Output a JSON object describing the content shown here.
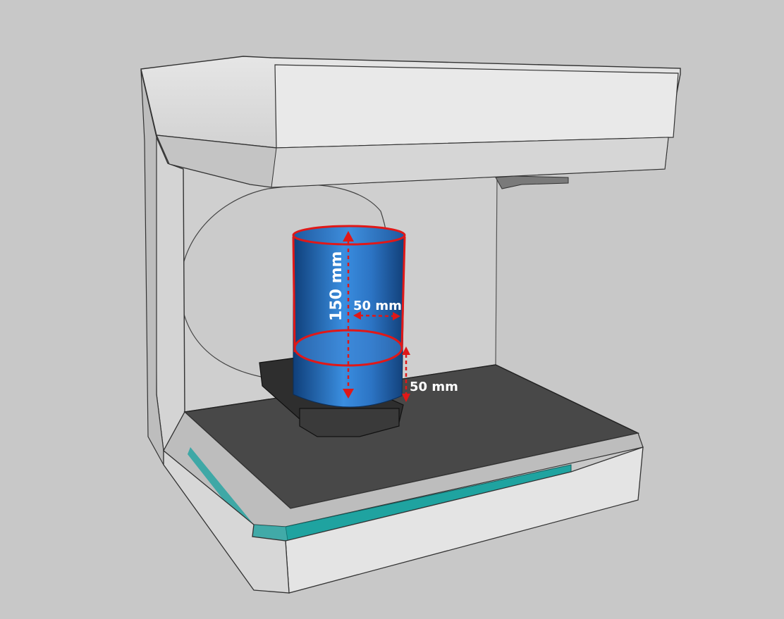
{
  "annotations": {
    "cylinder_height": "150 mm",
    "cylinder_radius": "50 mm",
    "base_clearance": "50 mm"
  },
  "colors": {
    "background": "#c8c8c8",
    "housing": "#dcdcdc",
    "housing_shadow": "#b9b9b9",
    "inner_panel": "#cfcfcf",
    "platform": "#484848",
    "teal_accent": "#1fa3a0",
    "cylinder_light": "#3d8fe0",
    "cylinder_dark": "#144d8f",
    "dimension_red": "#e01818"
  }
}
